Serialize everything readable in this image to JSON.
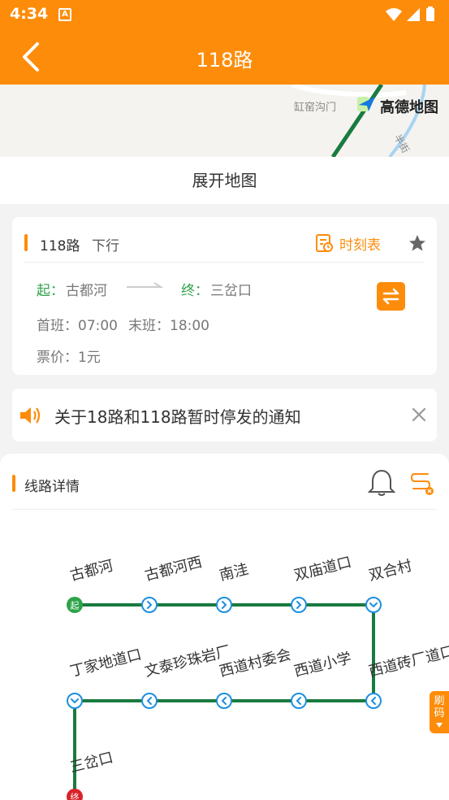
{
  "status_bar": {
    "time": "4:34",
    "notif": "A"
  },
  "header": {
    "title": "118路"
  },
  "map": {
    "place_label": "缸窑沟门",
    "brand": "高德地图",
    "road_label": "半街"
  },
  "expand_map_label": "展开地图",
  "route_info": {
    "route": "118路",
    "direction": "下行",
    "timetable_label": "时刻表",
    "start_label": "起：",
    "start_name": "古都河",
    "end_label": "终：",
    "end_name": "三岔口",
    "first_bus": "首班：07:00",
    "last_bus": "末班：18:00",
    "fare": "票价：1元"
  },
  "notice": {
    "text": "关于18路和118路暂时停发的通知"
  },
  "detail": {
    "title": "线路详情",
    "stops": [
      "古都河",
      "古都河西",
      "南洼",
      "双庙道口",
      "双合村",
      "西道砖厂道口",
      "西道小学",
      "西道村委会",
      "文泰珍珠岩厂",
      "丁家地道口",
      "三岔口"
    ],
    "start_marker": "起",
    "end_marker": "终"
  },
  "side_tab": {
    "line1": "刷",
    "line2": "码"
  },
  "colors": {
    "accent": "#fd8c0a",
    "line": "#1a7a40",
    "node": "#1d8fe0",
    "start": "#2ea34a",
    "end": "#d9232a"
  },
  "icons": [
    "back-arrow-icon",
    "timetable-icon",
    "star-icon",
    "swap-icon",
    "speaker-icon",
    "close-icon",
    "bell-icon",
    "route-filter-icon",
    "wifi-icon",
    "signal-icon",
    "battery-icon",
    "chevron-right-icon",
    "chevron-left-icon",
    "chevron-down-icon"
  ]
}
